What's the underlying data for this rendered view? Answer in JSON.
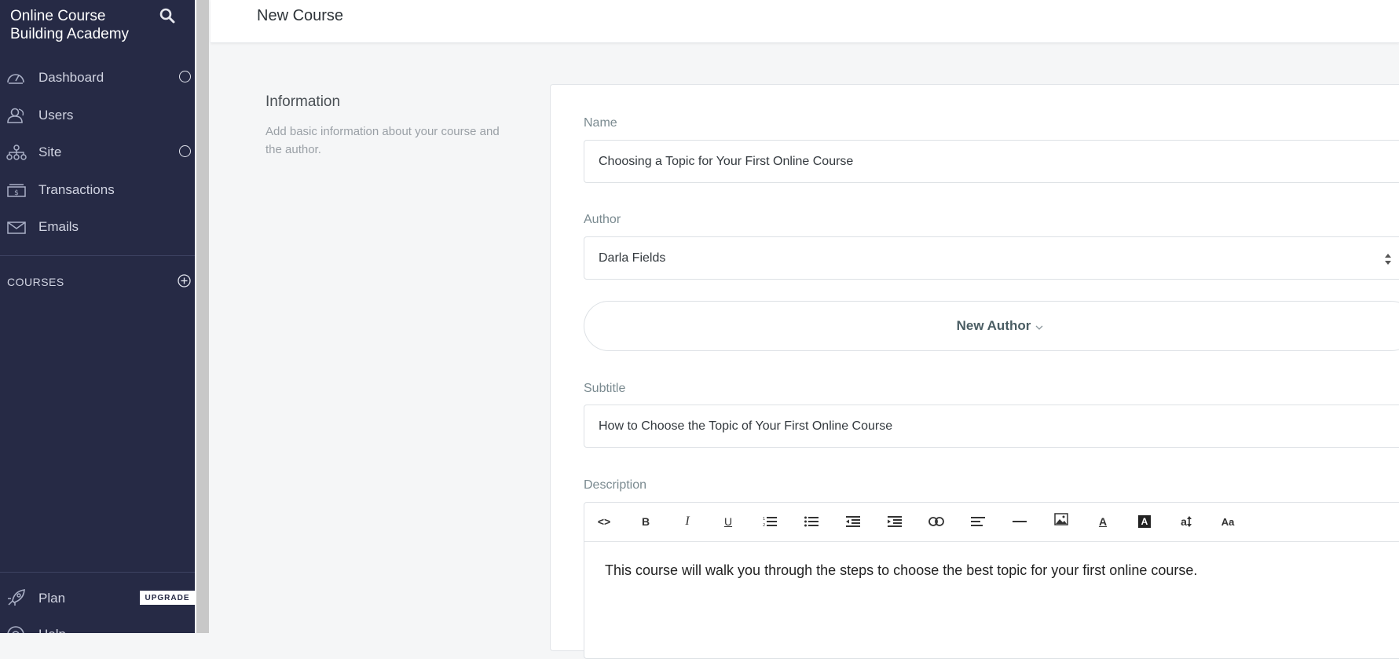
{
  "app": {
    "brand": "Online Course Building Academy"
  },
  "sidebar": {
    "items": [
      {
        "label": "Dashboard"
      },
      {
        "label": "Users"
      },
      {
        "label": "Site"
      },
      {
        "label": "Transactions"
      },
      {
        "label": "Emails"
      }
    ],
    "courses_heading": "COURSES",
    "plan_label": "Plan",
    "upgrade_label": "UPGRADE",
    "help_label": "Help"
  },
  "header": {
    "title": "New Course"
  },
  "info_section": {
    "title": "Information",
    "description": "Add basic information about your course and the author."
  },
  "form": {
    "name_label": "Name",
    "name_value": "Choosing a Topic for Your First Online Course",
    "author_label": "Author",
    "author_value": "Darla Fields",
    "new_author_label": "New Author",
    "subtitle_label": "Subtitle",
    "subtitle_value": "How to Choose the Topic of Your First Online Course",
    "description_label": "Description",
    "description_text": "This course will walk you through the steps to choose the best topic for your first online course."
  },
  "editor_toolbar": {
    "code": "<>",
    "bold": "B",
    "italic": "I",
    "underline": "U",
    "font_color": "A",
    "highlight": "A",
    "font_size": "a",
    "case": "Aa"
  },
  "colors": {
    "sidebar_bg": "#262a45",
    "page_bg": "#f5f6f7"
  }
}
